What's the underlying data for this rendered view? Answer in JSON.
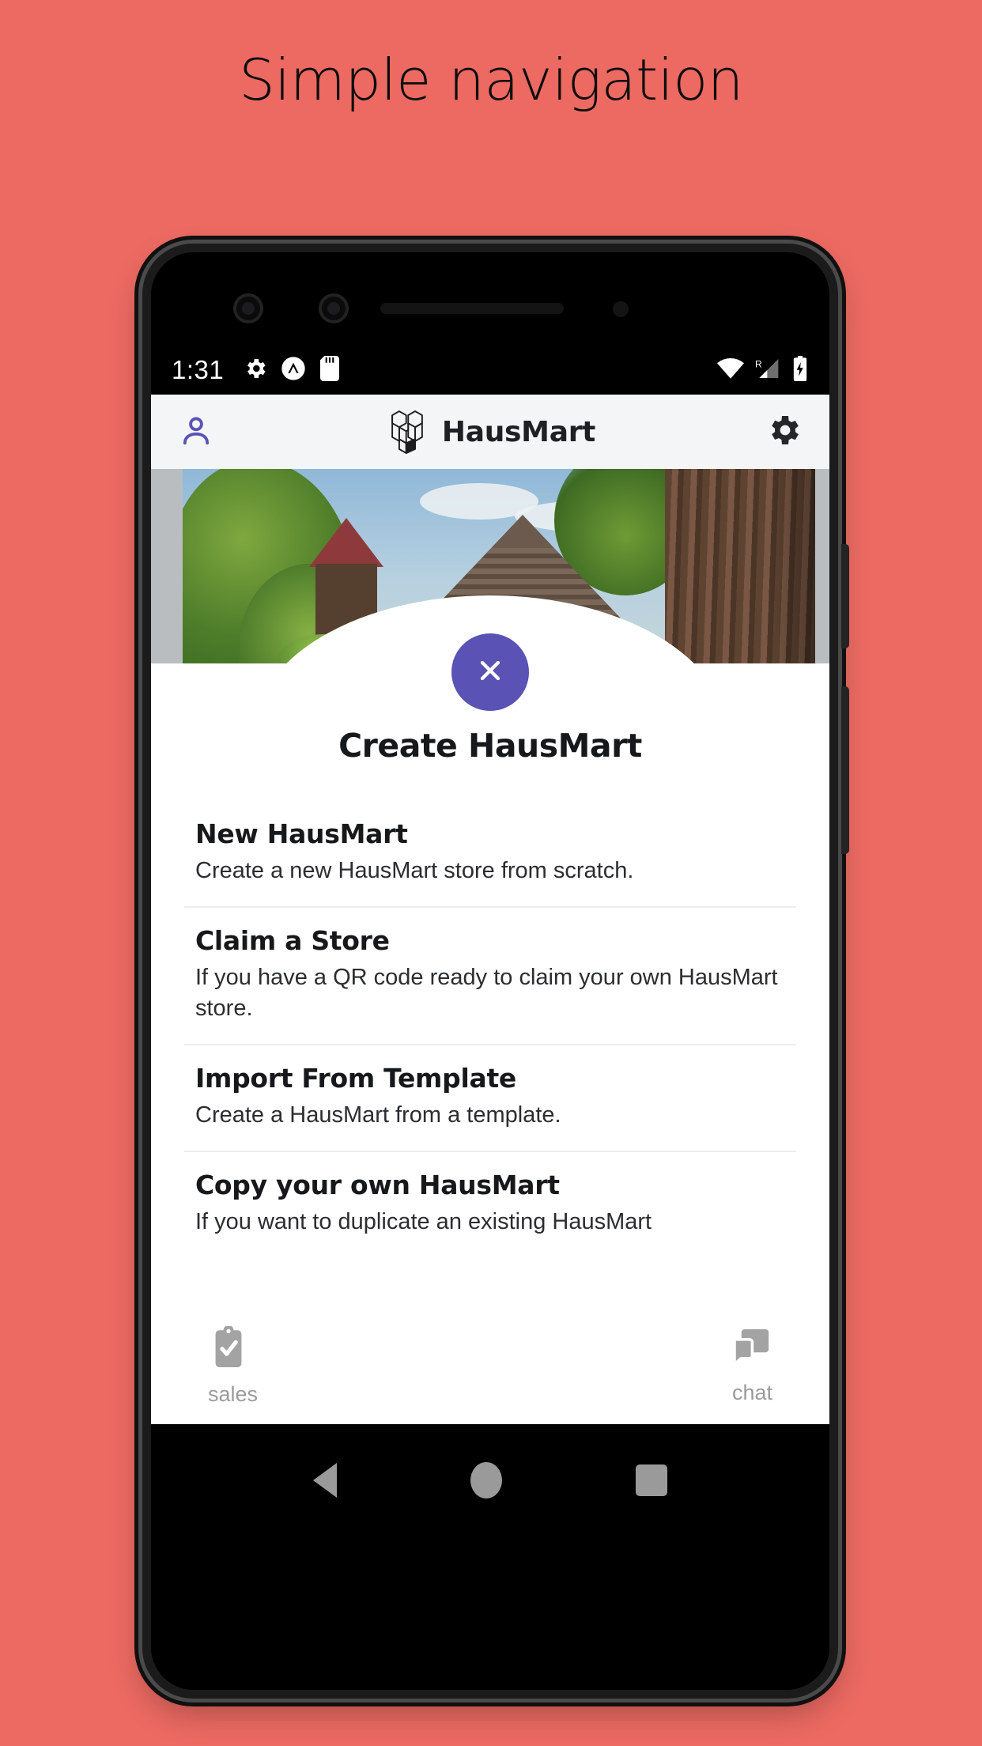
{
  "headline": "Simple navigation",
  "theme": {
    "background": "#ec6a62",
    "accent_purple": "#5b52b5",
    "appbar_bg": "#f4f5f7",
    "muted_grey": "#9b9b9b"
  },
  "status_bar": {
    "time": "1:31",
    "left_icons": [
      "gear-icon",
      "apex-launcher-icon",
      "sd-card-icon"
    ],
    "right_icons": [
      "wifi-icon",
      "cell-signal-roaming-icon",
      "battery-charging-icon"
    ],
    "roaming_label": "R"
  },
  "app_bar": {
    "account_icon": "person-icon",
    "logo_icon": "hausmart-isometric-logo",
    "title": "HausMart",
    "settings_icon": "gear-icon"
  },
  "hero": {
    "alt": "Rustic wooden cabin among redwood trees"
  },
  "sheet": {
    "close_icon": "close-x-icon",
    "title": "Create HausMart",
    "options": [
      {
        "title": "New HausMart",
        "description": "Create a new HausMart store from scratch."
      },
      {
        "title": "Claim a Store",
        "description": "If you have a QR code ready to claim your own HausMart store."
      },
      {
        "title": "Import From Template",
        "description": "Create a HausMart from a template."
      },
      {
        "title": "Copy your own HausMart",
        "description": "If you want to duplicate an existing HausMart"
      }
    ]
  },
  "tab_bar": {
    "tabs": [
      {
        "label": "sales",
        "icon": "clipboard-check-icon"
      },
      {
        "label": "chat",
        "icon": "chat-bubbles-icon"
      }
    ]
  },
  "android_nav": {
    "back": "back-triangle-icon",
    "home": "home-circle-icon",
    "recents": "recents-square-icon"
  }
}
